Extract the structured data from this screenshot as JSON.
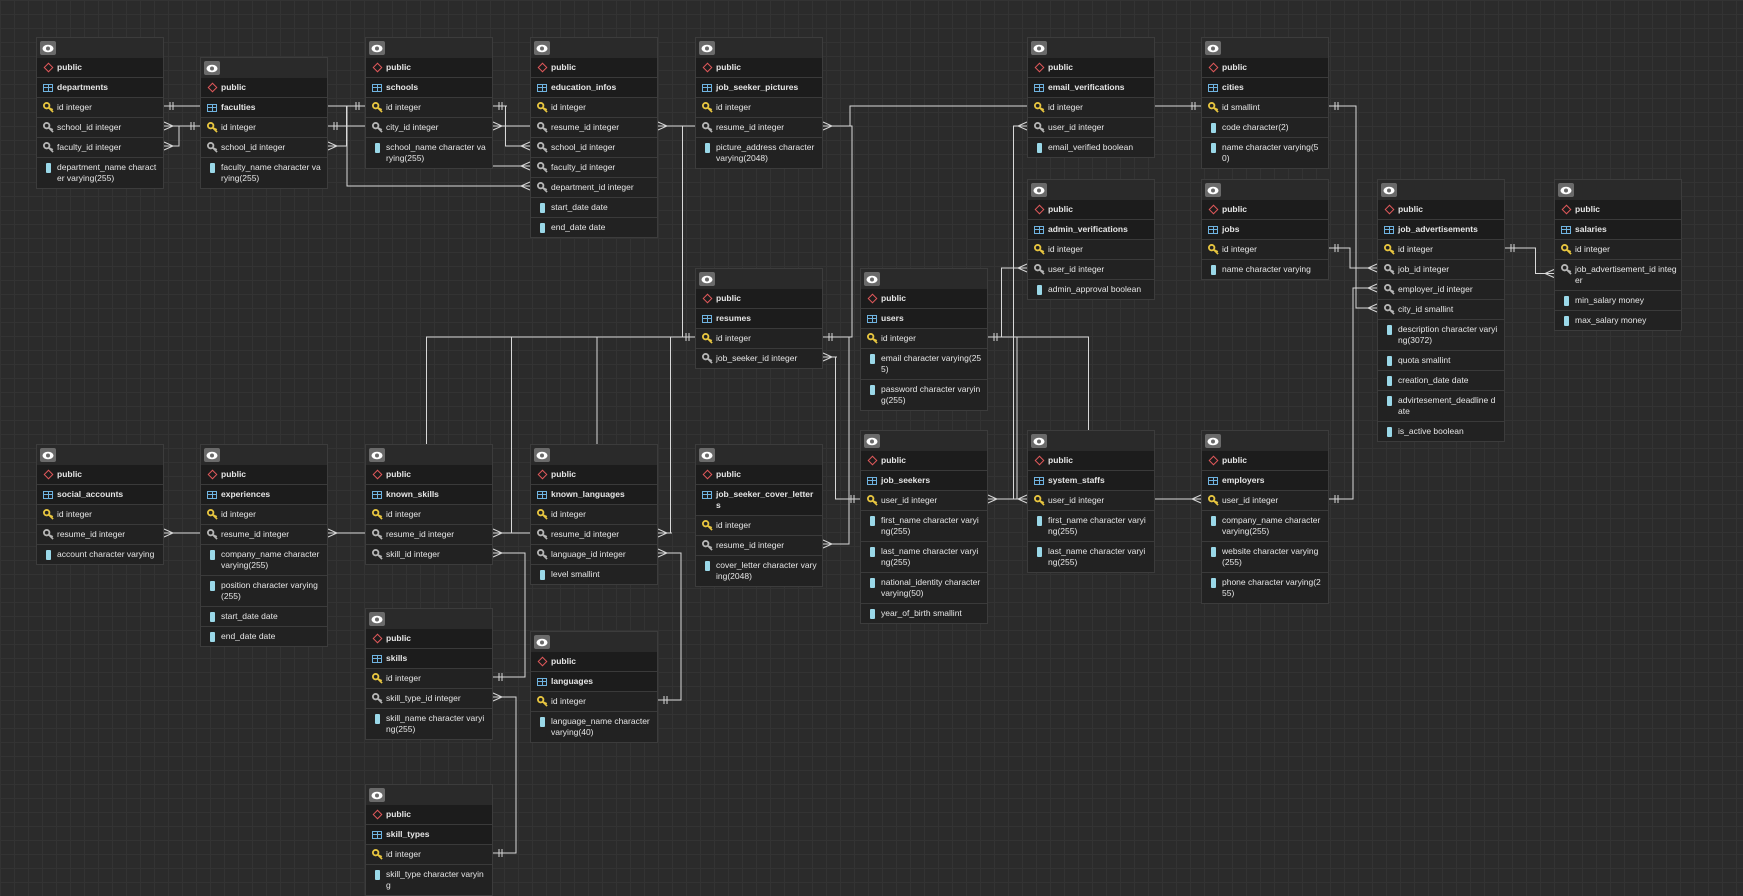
{
  "tables": [
    {
      "id": "departments",
      "schema": "public",
      "name": "departments",
      "cols": [
        {
          "icon": "primary-key-icon",
          "text": "id integer"
        },
        {
          "icon": "foreign-key-icon",
          "text": "school_id integer"
        },
        {
          "icon": "foreign-key-icon",
          "text": "faculty_id integer"
        },
        {
          "icon": "column-icon",
          "text": "department_name character varying(255)"
        }
      ]
    },
    {
      "id": "faculties",
      "schema": "public",
      "name": "faculties",
      "cols": [
        {
          "icon": "primary-key-icon",
          "text": "id integer"
        },
        {
          "icon": "foreign-key-icon",
          "text": "school_id integer"
        },
        {
          "icon": "column-icon",
          "text": "faculty_name character varying(255)"
        }
      ]
    },
    {
      "id": "schools",
      "schema": "public",
      "name": "schools",
      "cols": [
        {
          "icon": "primary-key-icon",
          "text": "id integer"
        },
        {
          "icon": "foreign-key-icon",
          "text": "city_id integer"
        },
        {
          "icon": "column-icon",
          "text": "school_name character varying(255)"
        }
      ]
    },
    {
      "id": "education_infos",
      "schema": "public",
      "name": "education_infos",
      "cols": [
        {
          "icon": "primary-key-icon",
          "text": "id integer"
        },
        {
          "icon": "foreign-key-icon",
          "text": "resume_id integer"
        },
        {
          "icon": "foreign-key-icon",
          "text": "school_id integer"
        },
        {
          "icon": "foreign-key-icon",
          "text": "faculty_id integer"
        },
        {
          "icon": "foreign-key-icon",
          "text": "department_id integer"
        },
        {
          "icon": "column-icon",
          "text": "start_date date"
        },
        {
          "icon": "column-icon",
          "text": "end_date date"
        }
      ]
    },
    {
      "id": "job_seeker_pictures",
      "schema": "public",
      "name": "job_seeker_pictures",
      "cols": [
        {
          "icon": "primary-key-icon",
          "text": "id integer"
        },
        {
          "icon": "foreign-key-icon",
          "text": "resume_id integer"
        },
        {
          "icon": "column-icon",
          "text": "picture_address character varying(2048)"
        }
      ]
    },
    {
      "id": "email_verifications",
      "schema": "public",
      "name": "email_verifications",
      "cols": [
        {
          "icon": "primary-key-icon",
          "text": "id integer"
        },
        {
          "icon": "foreign-key-icon",
          "text": "user_id integer"
        },
        {
          "icon": "column-icon",
          "text": "email_verified boolean"
        }
      ]
    },
    {
      "id": "cities",
      "schema": "public",
      "name": "cities",
      "cols": [
        {
          "icon": "primary-key-icon",
          "text": "id smallint"
        },
        {
          "icon": "column-icon",
          "text": "code character(2)"
        },
        {
          "icon": "column-icon",
          "text": "name character varying(50)"
        }
      ]
    },
    {
      "id": "admin_verifications",
      "schema": "public",
      "name": "admin_verifications",
      "cols": [
        {
          "icon": "primary-key-icon",
          "text": "id integer"
        },
        {
          "icon": "foreign-key-icon",
          "text": "user_id integer"
        },
        {
          "icon": "column-icon",
          "text": "admin_approval boolean"
        }
      ]
    },
    {
      "id": "jobs",
      "schema": "public",
      "name": "jobs",
      "cols": [
        {
          "icon": "primary-key-icon",
          "text": "id integer"
        },
        {
          "icon": "column-icon",
          "text": "name character varying"
        }
      ]
    },
    {
      "id": "job_advertisements",
      "schema": "public",
      "name": "job_advertisements",
      "cols": [
        {
          "icon": "primary-key-icon",
          "text": "id integer"
        },
        {
          "icon": "foreign-key-icon",
          "text": "job_id integer"
        },
        {
          "icon": "foreign-key-icon",
          "text": "employer_id integer"
        },
        {
          "icon": "foreign-key-icon",
          "text": "city_id smallint"
        },
        {
          "icon": "column-icon",
          "text": "description character varying(3072)"
        },
        {
          "icon": "column-icon",
          "text": "quota smallint"
        },
        {
          "icon": "column-icon",
          "text": "creation_date date"
        },
        {
          "icon": "column-icon",
          "text": "advirtesement_deadline date"
        },
        {
          "icon": "column-icon",
          "text": "is_active boolean"
        }
      ]
    },
    {
      "id": "salaries",
      "schema": "public",
      "name": "salaries",
      "cols": [
        {
          "icon": "primary-key-icon",
          "text": "id integer"
        },
        {
          "icon": "foreign-key-icon",
          "text": "job_advertisement_id integer"
        },
        {
          "icon": "column-icon",
          "text": "min_salary money"
        },
        {
          "icon": "column-icon",
          "text": "max_salary money"
        }
      ]
    },
    {
      "id": "resumes",
      "schema": "public",
      "name": "resumes",
      "cols": [
        {
          "icon": "primary-key-icon",
          "text": "id integer"
        },
        {
          "icon": "foreign-key-icon",
          "text": "job_seeker_id integer"
        }
      ]
    },
    {
      "id": "users",
      "schema": "public",
      "name": "users",
      "cols": [
        {
          "icon": "primary-key-icon",
          "text": "id integer"
        },
        {
          "icon": "column-icon",
          "text": "email character varying(255)"
        },
        {
          "icon": "column-icon",
          "text": "password character varying(255)"
        }
      ]
    },
    {
      "id": "social_accounts",
      "schema": "public",
      "name": "social_accounts",
      "cols": [
        {
          "icon": "primary-key-icon",
          "text": "id integer"
        },
        {
          "icon": "foreign-key-icon",
          "text": "resume_id integer"
        },
        {
          "icon": "column-icon",
          "text": "account character varying"
        }
      ]
    },
    {
      "id": "experiences",
      "schema": "public",
      "name": "experiences",
      "cols": [
        {
          "icon": "primary-key-icon",
          "text": "id integer"
        },
        {
          "icon": "foreign-key-icon",
          "text": "resume_id integer"
        },
        {
          "icon": "column-icon",
          "text": "company_name character varying(255)"
        },
        {
          "icon": "column-icon",
          "text": "position character varying(255)"
        },
        {
          "icon": "column-icon",
          "text": "start_date date"
        },
        {
          "icon": "column-icon",
          "text": "end_date date"
        }
      ]
    },
    {
      "id": "known_skills",
      "schema": "public",
      "name": "known_skills",
      "cols": [
        {
          "icon": "primary-key-icon",
          "text": "id integer"
        },
        {
          "icon": "foreign-key-icon",
          "text": "resume_id integer"
        },
        {
          "icon": "foreign-key-icon",
          "text": "skill_id integer"
        }
      ]
    },
    {
      "id": "known_languages",
      "schema": "public",
      "name": "known_languages",
      "cols": [
        {
          "icon": "primary-key-icon",
          "text": "id integer"
        },
        {
          "icon": "foreign-key-icon",
          "text": "resume_id integer"
        },
        {
          "icon": "foreign-key-icon",
          "text": "language_id integer"
        },
        {
          "icon": "column-icon",
          "text": "level smallint"
        }
      ]
    },
    {
      "id": "job_seeker_cover_letters",
      "schema": "public",
      "name": "job_seeker_cover_letters",
      "cols": [
        {
          "icon": "primary-key-icon",
          "text": "id integer"
        },
        {
          "icon": "foreign-key-icon",
          "text": "resume_id integer"
        },
        {
          "icon": "column-icon",
          "text": "cover_letter character varying(2048)"
        }
      ]
    },
    {
      "id": "job_seekers",
      "schema": "public",
      "name": "job_seekers",
      "cols": [
        {
          "icon": "primary-key-icon",
          "text": "user_id integer"
        },
        {
          "icon": "column-icon",
          "text": "first_name character varying(255)"
        },
        {
          "icon": "column-icon",
          "text": "last_name character varying(255)"
        },
        {
          "icon": "column-icon",
          "text": "national_identity character varying(50)"
        },
        {
          "icon": "column-icon",
          "text": "year_of_birth smallint"
        }
      ]
    },
    {
      "id": "system_staffs",
      "schema": "public",
      "name": "system_staffs",
      "cols": [
        {
          "icon": "primary-key-icon",
          "text": "user_id integer"
        },
        {
          "icon": "column-icon",
          "text": "first_name character varying(255)"
        },
        {
          "icon": "column-icon",
          "text": "last_name character varying(255)"
        }
      ]
    },
    {
      "id": "employers",
      "schema": "public",
      "name": "employers",
      "cols": [
        {
          "icon": "primary-key-icon",
          "text": "user_id integer"
        },
        {
          "icon": "column-icon",
          "text": "company_name character varying(255)"
        },
        {
          "icon": "column-icon",
          "text": "website character varying(255)"
        },
        {
          "icon": "column-icon",
          "text": "phone character varying(255)"
        }
      ]
    },
    {
      "id": "skills",
      "schema": "public",
      "name": "skills",
      "cols": [
        {
          "icon": "primary-key-icon",
          "text": "id integer"
        },
        {
          "icon": "foreign-key-icon",
          "text": "skill_type_id integer"
        },
        {
          "icon": "column-icon",
          "text": "skill_name character varying(255)"
        }
      ]
    },
    {
      "id": "languages",
      "schema": "public",
      "name": "languages",
      "cols": [
        {
          "icon": "primary-key-icon",
          "text": "id integer"
        },
        {
          "icon": "column-icon",
          "text": "language_name character varying(40)"
        }
      ]
    },
    {
      "id": "skill_types",
      "schema": "public",
      "name": "skill_types",
      "cols": [
        {
          "icon": "primary-key-icon",
          "text": "id integer"
        },
        {
          "icon": "column-icon",
          "text": "skill_type character varying"
        }
      ]
    }
  ],
  "relations": [
    {
      "from": "departments.school_id",
      "to": "schools.id"
    },
    {
      "from": "departments.faculty_id",
      "to": "faculties.id"
    },
    {
      "from": "faculties.school_id",
      "to": "schools.id"
    },
    {
      "from": "schools.city_id",
      "to": "cities.id"
    },
    {
      "from": "education_infos.resume_id",
      "to": "resumes.id"
    },
    {
      "from": "education_infos.school_id",
      "to": "schools.id"
    },
    {
      "from": "education_infos.faculty_id",
      "to": "faculties.id"
    },
    {
      "from": "education_infos.department_id",
      "to": "departments.id"
    },
    {
      "from": "job_seeker_pictures.resume_id",
      "to": "resumes.id"
    },
    {
      "from": "email_verifications.user_id",
      "to": "users.id"
    },
    {
      "from": "admin_verifications.user_id",
      "to": "users.id"
    },
    {
      "from": "job_advertisements.job_id",
      "to": "jobs.id"
    },
    {
      "from": "job_advertisements.employer_id",
      "to": "employers.user_id"
    },
    {
      "from": "job_advertisements.city_id",
      "to": "cities.id"
    },
    {
      "from": "salaries.job_advertisement_id",
      "to": "job_advertisements.id"
    },
    {
      "from": "resumes.job_seeker_id",
      "to": "job_seekers.user_id"
    },
    {
      "from": "social_accounts.resume_id",
      "to": "resumes.id"
    },
    {
      "from": "experiences.resume_id",
      "to": "resumes.id"
    },
    {
      "from": "known_skills.resume_id",
      "to": "resumes.id"
    },
    {
      "from": "known_skills.skill_id",
      "to": "skills.id"
    },
    {
      "from": "known_languages.resume_id",
      "to": "resumes.id"
    },
    {
      "from": "known_languages.language_id",
      "to": "languages.id"
    },
    {
      "from": "job_seeker_cover_letters.resume_id",
      "to": "resumes.id"
    },
    {
      "from": "job_seekers.user_id",
      "to": "users.id"
    },
    {
      "from": "system_staffs.user_id",
      "to": "users.id"
    },
    {
      "from": "employers.user_id",
      "to": "users.id"
    },
    {
      "from": "skills.skill_type_id",
      "to": "skill_types.id"
    }
  ]
}
